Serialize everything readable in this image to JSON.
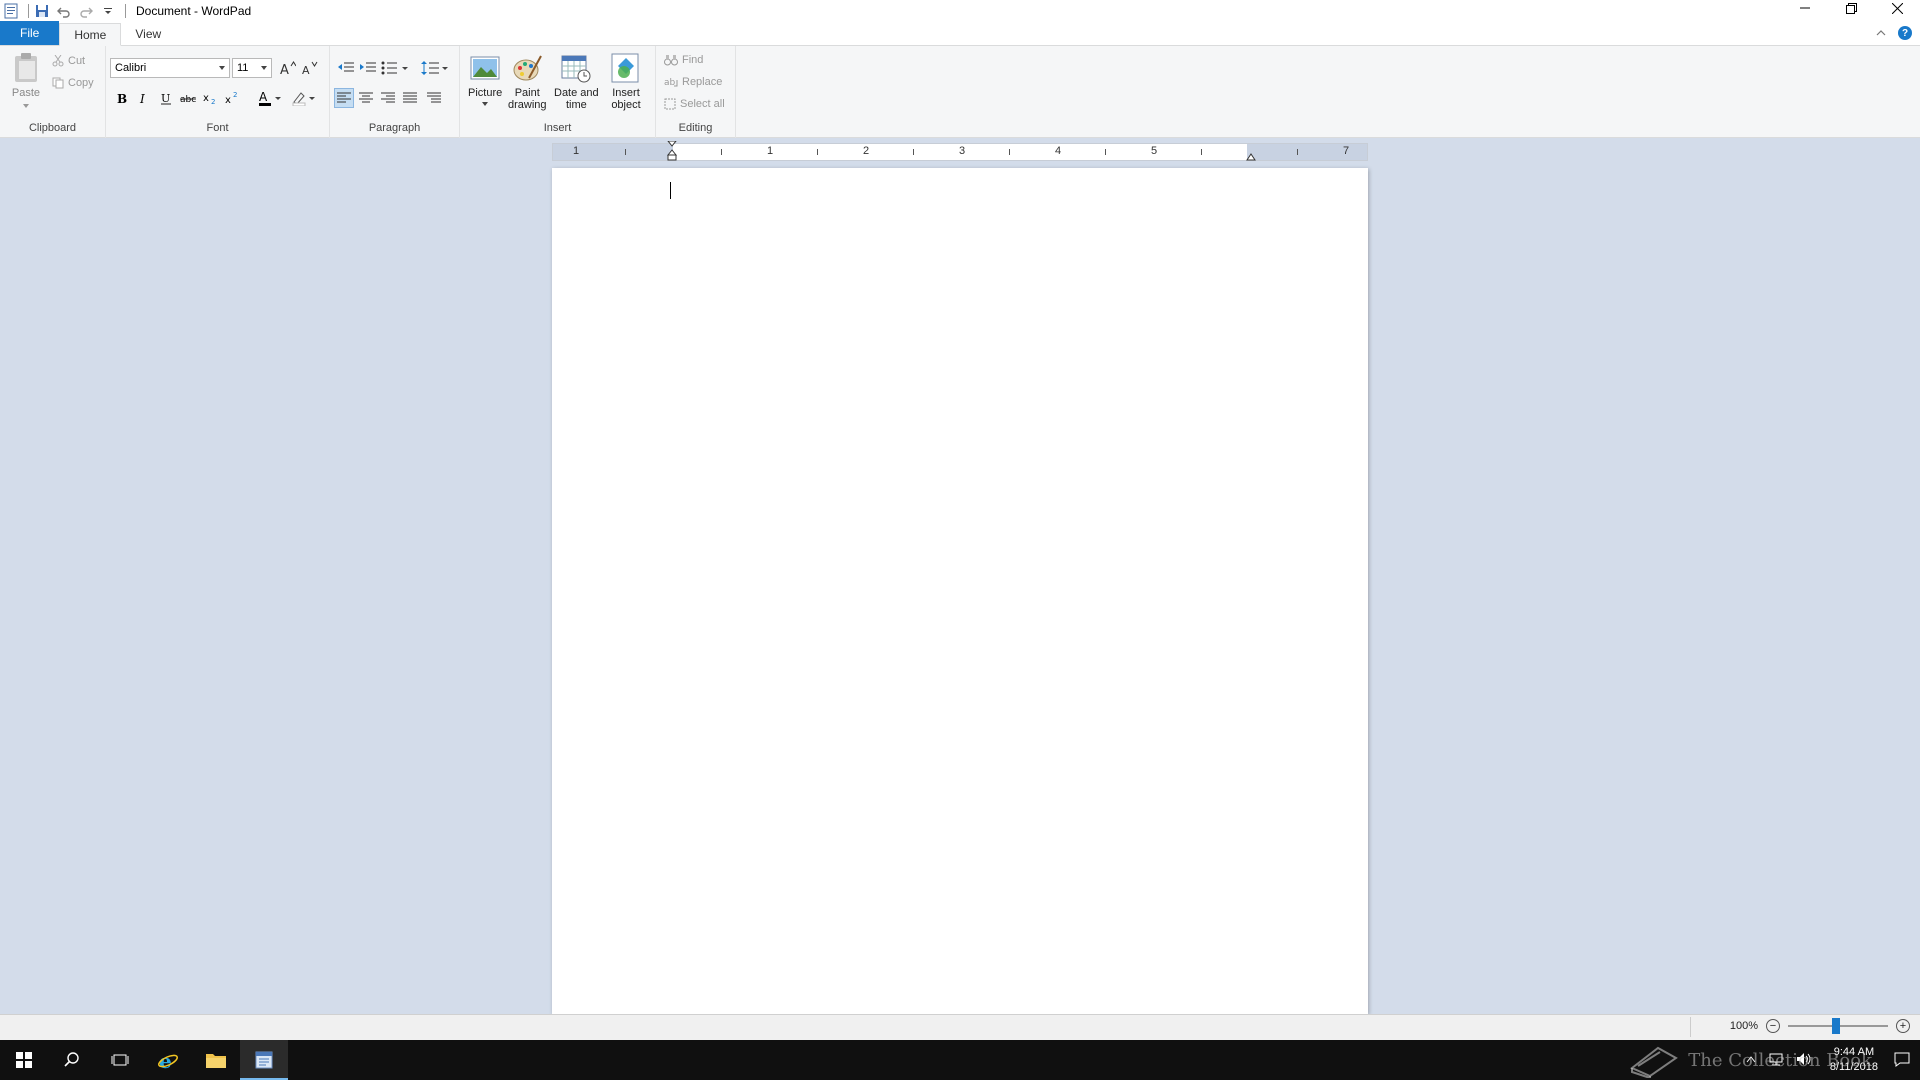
{
  "window": {
    "title": "Document - WordPad"
  },
  "tabs": [
    {
      "label": "File"
    },
    {
      "label": "Home"
    },
    {
      "label": "View"
    }
  ],
  "ribbon": {
    "clipboard": {
      "label": "Clipboard",
      "paste": "Paste",
      "cut": "Cut",
      "copy": "Copy"
    },
    "font": {
      "label": "Font",
      "family": "Calibri",
      "size": "11"
    },
    "paragraph": {
      "label": "Paragraph"
    },
    "insert": {
      "label": "Insert",
      "picture": "Picture",
      "paint_line1": "Paint",
      "paint_line2": "drawing",
      "datetime_line1": "Date and",
      "datetime_line2": "time",
      "object_line1": "Insert",
      "object_line2": "object"
    },
    "editing": {
      "label": "Editing",
      "find": "Find",
      "replace": "Replace",
      "select_all": "Select all"
    }
  },
  "ruler": {
    "numbers": [
      "1",
      "1",
      "2",
      "3",
      "4",
      "5",
      "7"
    ]
  },
  "statusbar": {
    "zoom": "100%",
    "zoom_level_percent": 100
  },
  "taskbar": {
    "time": "9:44 AM",
    "date": "8/11/2018"
  },
  "watermark": "The Collection Book",
  "colors": {
    "accent": "#1979ca",
    "ribbon_bg": "#f5f6f7",
    "workspace_bg": "#d3dcea",
    "taskbar_bg": "#101010"
  }
}
